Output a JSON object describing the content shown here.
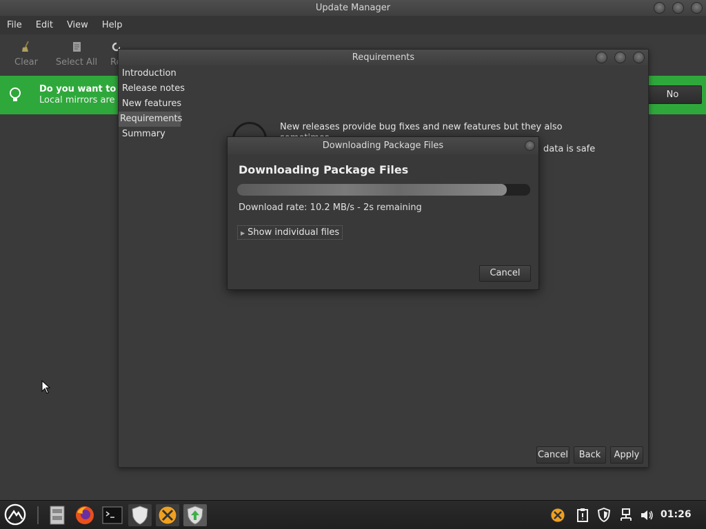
{
  "main_window": {
    "title": "Update Manager",
    "menu": [
      "File",
      "Edit",
      "View",
      "Help"
    ],
    "toolbar": {
      "clear": "Clear",
      "select_all": "Select All",
      "refresh_partial": "Re"
    },
    "infobar": {
      "title": "Do you want to sw",
      "subtitle": "Local mirrors are us",
      "no_button": "No"
    }
  },
  "requirements_window": {
    "title": "Requirements",
    "nav": [
      "Introduction",
      "Release notes",
      "New features",
      "Requirements",
      "Summary"
    ],
    "selected_nav": "Requirements",
    "body_line1": "New releases provide bug fixes and new features but they also sometimes",
    "body_line2_end": "data is safe",
    "buttons": {
      "cancel": "Cancel",
      "back": "Back",
      "apply": "Apply"
    }
  },
  "download_dialog": {
    "title": "Downloading Package Files",
    "heading": "Downloading Package Files",
    "progress": 0.92,
    "rate_text": "Download rate: 10.2 MB/s - 2s remaining",
    "expander_label": "Show individual files",
    "cancel_label": "Cancel"
  },
  "taskbar": {
    "clock": "01:26",
    "apps": [
      "menu-icon",
      "file-manager-icon",
      "firefox-icon",
      "terminal-icon",
      "shield-icon",
      "update-x-icon",
      "update-manager-icon"
    ],
    "tray": [
      "update-x-tray-icon",
      "clipboard-icon",
      "shield-tray-icon",
      "network-icon",
      "volume-icon"
    ]
  },
  "colors": {
    "infobar_green": "#2fa83b",
    "window_bg": "#3b3b3b",
    "desktop_bg": "#3a3a3a"
  }
}
